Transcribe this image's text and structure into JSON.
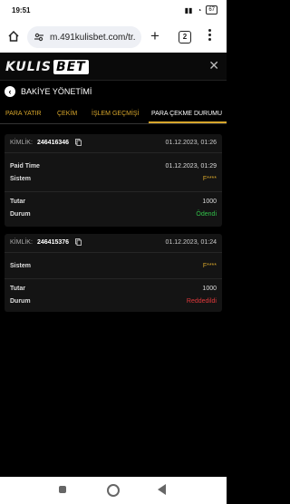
{
  "status_bar": {
    "time": "19:51",
    "battery": "67"
  },
  "browser": {
    "url": "m.491kulisbet.com/tr.",
    "tab_count": "2",
    "plus": "+"
  },
  "site": {
    "logo_main": "KULIS",
    "logo_bet": "BET",
    "close": "✕"
  },
  "page": {
    "back": "‹",
    "title": "BAKİYE YÖNETİMİ"
  },
  "tabs": [
    {
      "label": "PARA YATIR"
    },
    {
      "label": "ÇEKİM"
    },
    {
      "label": "İŞLEM GEÇMİŞİ"
    },
    {
      "label": "PARA ÇEKME DURUMU",
      "active": true
    }
  ],
  "transactions": [
    {
      "kimlik_label": "KİMLİK:",
      "kimlik": "246416346",
      "date": "01.12.2023, 01:26",
      "paid_time_label": "Paid Time",
      "paid_time": "01.12.2023, 01:29",
      "sistem_label": "Sistem",
      "sistem": "F****",
      "tutar_label": "Tutar",
      "tutar": "1000",
      "durum_label": "Durum",
      "durum": "Ödendi"
    },
    {
      "kimlik_label": "KİMLİK:",
      "kimlik": "246415376",
      "date": "01.12.2023, 01:24",
      "sistem_label": "Sistem",
      "sistem": "F****",
      "tutar_label": "Tutar",
      "tutar": "1000",
      "durum_label": "Durum",
      "durum": "Reddedildi"
    }
  ],
  "colors": {
    "accent": "#d6a52b",
    "success": "#32c04a",
    "danger": "#e0393b"
  }
}
